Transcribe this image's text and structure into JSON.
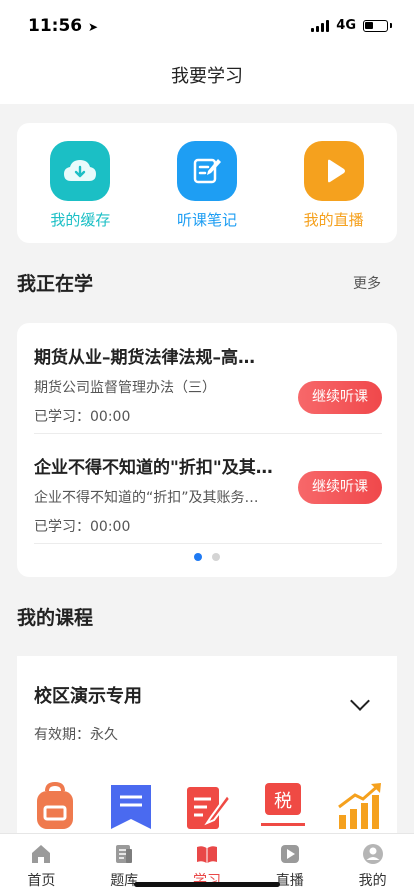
{
  "status": {
    "time": "11:56",
    "network": "4G"
  },
  "header": {
    "title": "我要学习"
  },
  "quick_actions": [
    {
      "label": "我的缓存",
      "color": "#1bbfc5",
      "icon": "download-cloud-icon"
    },
    {
      "label": "听课笔记",
      "color": "#1e9ef3",
      "icon": "note-edit-icon"
    },
    {
      "label": "我的直播",
      "color": "#f5a11e",
      "icon": "play-icon"
    }
  ],
  "learning": {
    "section_title": "我正在学",
    "more_label": "更多",
    "items": [
      {
        "title": "期货从业–期货法律法规–高…",
        "subtitle": "期货公司监督管理办法（三）",
        "progress": "已学习：00:00",
        "button": "继续听课"
      },
      {
        "title": "企业不得不知道的\"折扣\"及其…",
        "subtitle": "企业不得不知道的“折扣”及其账务…",
        "progress": "已学习：00:00",
        "button": "继续听课"
      }
    ],
    "page_count": 2,
    "active_page": 1
  },
  "courses": {
    "section_title": "我的课程",
    "name": "校区演示专用",
    "validity": "有效期：永久",
    "tax_badge": "税"
  },
  "tabs": [
    {
      "label": "首页",
      "icon": "home-icon",
      "active": false
    },
    {
      "label": "题库",
      "icon": "question-bank-icon",
      "active": false
    },
    {
      "label": "学习",
      "icon": "book-icon",
      "active": true
    },
    {
      "label": "直播",
      "icon": "live-icon",
      "active": false
    },
    {
      "label": "我的",
      "icon": "profile-icon",
      "active": false
    }
  ],
  "colors": {
    "accent": "#e94848",
    "button_red": "#f0484b",
    "dot_active": "#1f7af3"
  }
}
